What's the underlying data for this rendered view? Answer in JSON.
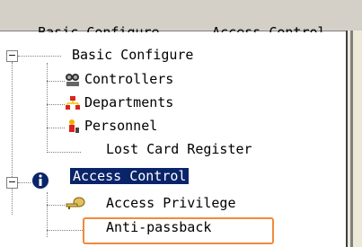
{
  "menubar": {
    "items": [
      {
        "label": "Basic Configure",
        "underline": "B"
      },
      {
        "label": "Access Control",
        "underline": "C"
      }
    ]
  },
  "tree": {
    "basic_configure": {
      "label": "Basic Configure",
      "children": [
        "Controllers",
        "Departments",
        "Personnel",
        "Lost Card Register"
      ]
    },
    "access_control": {
      "label": "Access Control",
      "children": [
        "Access Privilege",
        "Anti-passback"
      ]
    }
  },
  "colors": {
    "highlight_box": "#f08a3c",
    "selection_bg": "#0a246a"
  }
}
